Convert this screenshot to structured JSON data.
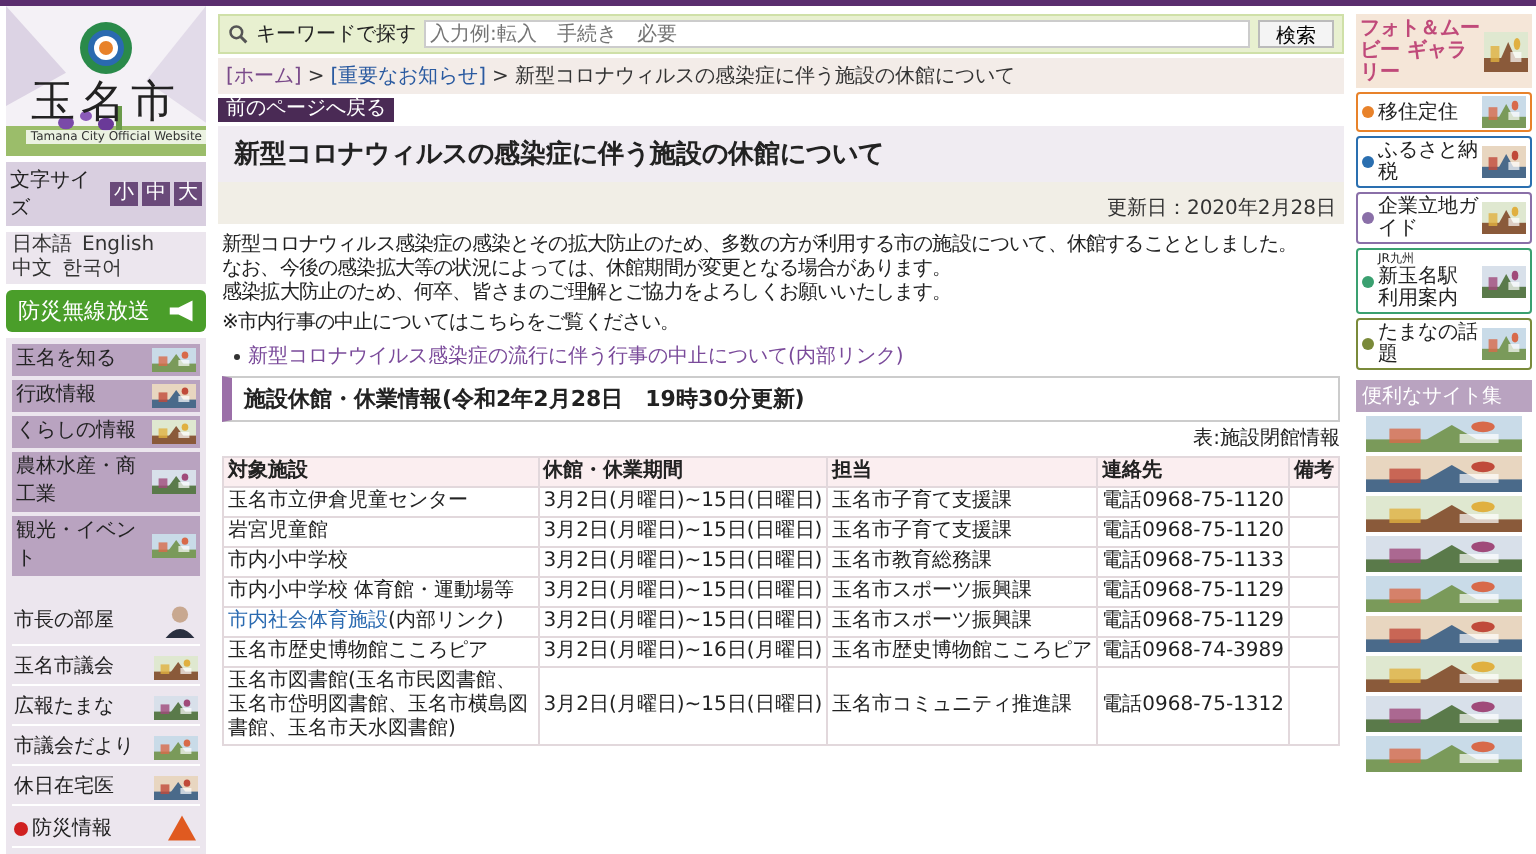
{
  "site": {
    "name": "玉名市",
    "subtitle": "Tamana City Official Website",
    "font_size": {
      "label": "文字サイズ",
      "options": [
        "小",
        "中",
        "大"
      ]
    },
    "languages": [
      "日本語",
      "English",
      "中文",
      "한국어"
    ]
  },
  "disaster_radio": "防災無線放送",
  "menu": [
    "玉名を知る",
    "行政情報",
    "くらしの情報",
    "農林水産・商工業",
    "観光・イベント"
  ],
  "side_links": [
    {
      "label": "市長の部屋",
      "kind": "person"
    },
    {
      "label": "玉名市議会",
      "kind": "thumb"
    },
    {
      "label": "広報たまな",
      "kind": "thumb"
    },
    {
      "label": "市議会だより",
      "kind": "thumb"
    },
    {
      "label": "休日在宅医",
      "kind": "thumb"
    },
    {
      "label": "防災情報",
      "kind": "alert"
    }
  ],
  "search": {
    "label": "キーワードで探す",
    "placeholder": "入力例:転入　手続き　必要",
    "button": "検索"
  },
  "breadcrumb": [
    {
      "text": "[ホーム]",
      "link": true
    },
    {
      "separator": ">",
      "text": "[重要なお知らせ]",
      "link": true
    },
    {
      "separator": ">",
      "text": "新型コロナウィルスの感染症に伴う施設の休館について",
      "link": false
    }
  ],
  "back_button": "前のページへ戻る",
  "title": "新型コロナウィルスの感染症に伴う施設の休館について",
  "updated": "更新日：2020年2月28日",
  "paragraphs": [
    "新型コロナウィルス感染症の感染とその拡大防止のため、多数の方が利用する市の施設について、休館することとしました。",
    "なお、今後の感染拡大等の状況によっては、休館期間が変更となる場合があります。",
    "感染拡大防止のため、何卒、皆さまのご理解とご協力をよろしくお願いいたします。"
  ],
  "note": "※市内行事の中止についてはこちらをご覧ください。",
  "links": [
    "新型コロナウイルス感染症の流行に伴う行事の中止について(内部リンク)"
  ],
  "section_heading": "施設休館・休業情報(令和2年2月28日　19時30分更新)",
  "table": {
    "caption": "表:施設閉館情報",
    "columns": [
      "対象施設",
      "休館・休業期間",
      "担当",
      "連絡先",
      "備考"
    ],
    "rows": [
      {
        "facility": "玉名市立伊倉児童センター",
        "period": "3月2日(月曜日)~15日(日曜日)",
        "department": "玉名市子育て支援課",
        "contact": "電話0968-75-1120"
      },
      {
        "facility": "岩宮児童館",
        "period": "3月2日(月曜日)~15日(日曜日)",
        "department": "玉名市子育て支援課",
        "contact": "電話0968-75-1120"
      },
      {
        "facility": "市内小中学校",
        "period": "3月2日(月曜日)~15日(日曜日)",
        "department": "玉名市教育総務課",
        "contact": "電話0968-75-1133"
      },
      {
        "facility": "市内小中学校 体育館・運動場等",
        "period": "3月2日(月曜日)~15日(日曜日)",
        "department": "玉名市スポーツ振興課",
        "contact": "電話0968-75-1129"
      },
      {
        "facility_link": "市内社会体育施設",
        "facility": "(内部リンク)",
        "period": "3月2日(月曜日)~15日(日曜日)",
        "department": "玉名市スポーツ振興課",
        "contact": "電話0968-75-1129"
      },
      {
        "facility": "玉名市歴史博物館こころピア",
        "period": "3月2日(月曜日)~16日(月曜日)",
        "department": "玉名市歴史博物館こころピア",
        "contact": "電話0968-74-3989"
      },
      {
        "facility": "玉名市図書館(玉名市民図書館、玉名市岱明図書館、玉名市横島図書館、玉名市天水図書館)",
        "period": "3月2日(月曜日)~15日(日曜日)",
        "department": "玉名市コミュニティ推進課",
        "contact": "電話0968-75-1312"
      }
    ]
  },
  "gallery": "フォト＆ムービー ギャラリー",
  "right_banners": [
    {
      "label": "移住定住",
      "color": "#e8822a"
    },
    {
      "label": "ふるさと納税",
      "color": "#2a6fb0"
    },
    {
      "label": "企業立地ガイド",
      "color": "#8a6fa8"
    },
    {
      "sub": "JR九州",
      "label": "新玉名駅",
      "label_2": "利用案内",
      "color": "#3aa070"
    },
    {
      "label": "たまなの話題",
      "color": "#7a8a3a"
    }
  ],
  "useful_sites": "便利なサイト集",
  "site_banners": [
    {
      "kind": "picture"
    },
    {
      "kind": "picture"
    },
    {
      "kind": "picture"
    },
    {
      "kind": "picture"
    },
    {
      "kind": "picture"
    },
    {
      "kind": "picture"
    },
    {
      "kind": "picture"
    },
    {
      "kind": "picture"
    },
    {
      "kind": "picture"
    }
  ]
}
